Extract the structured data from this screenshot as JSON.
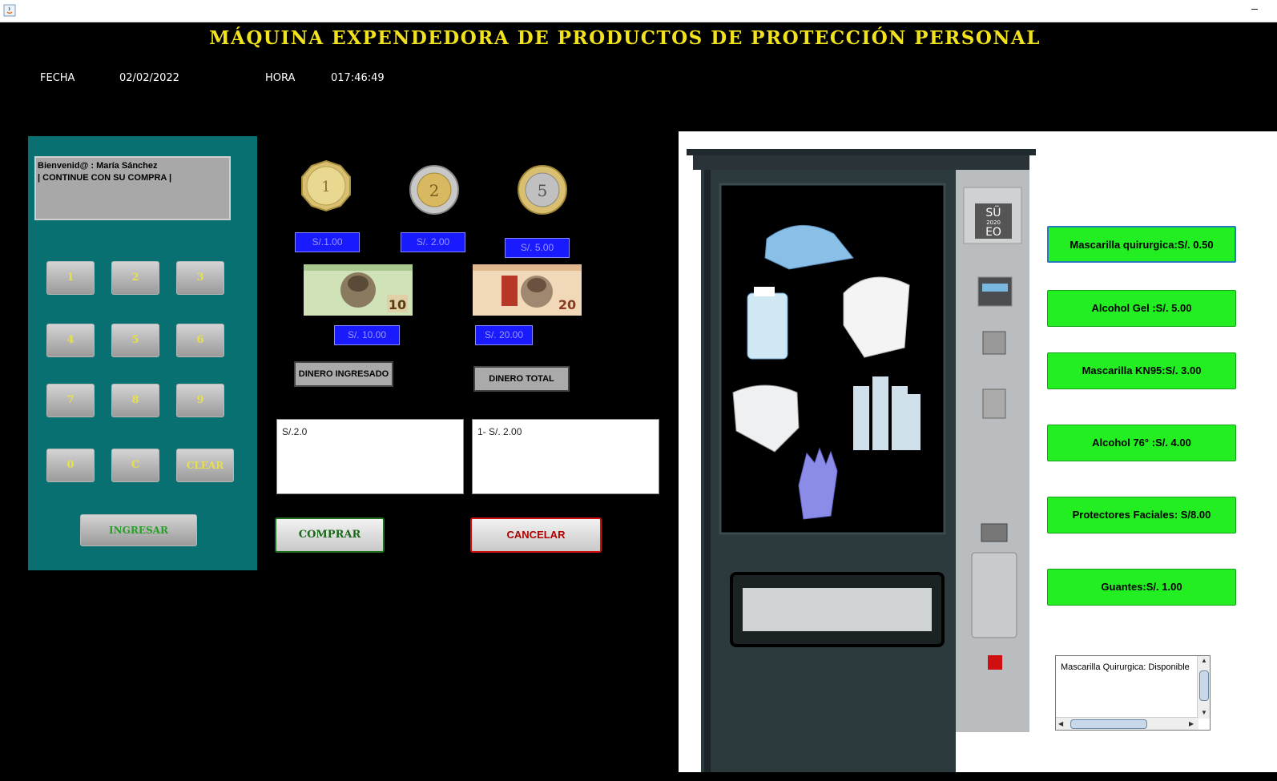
{
  "title": "MÁQUINA EXPENDEDORA DE PRODUCTOS DE PROTECCIÓN PERSONAL",
  "window": {
    "minimize": "–"
  },
  "header": {
    "fecha_label": "FECHA",
    "fecha_value": "02/02/2022",
    "hora_label": "HORA",
    "hora_value": "017:46:49"
  },
  "message": {
    "line1": "Bienvenid@ : María Sánchez",
    "line2": "| CONTINUE CON  SU COMPRA |"
  },
  "keypad": {
    "k1": "1",
    "k2": "2",
    "k3": "3",
    "k4": "4",
    "k5": "5",
    "k6": "6",
    "k7": "7",
    "k8": "8",
    "k9": "9",
    "k0": "0",
    "kc": "C",
    "clear": "CLEAR",
    "ingresar": "INGRESAR"
  },
  "money": {
    "coin1": "S/.1.00",
    "coin2": "S/. 2.00",
    "coin5": "S/. 5.00",
    "bill10": "S/. 10.00",
    "bill20": "S/. 20.00",
    "bill10_mark": "10",
    "bill20_mark": "20"
  },
  "labels": {
    "dinero_ingresado": "DINERO INGRESADO",
    "dinero_total": "DINERO TOTAL"
  },
  "fields": {
    "ingresado_value": "S/.2.0",
    "total_value": "1- S/. 2.00"
  },
  "actions": {
    "comprar": "COMPRAR",
    "cancelar": "CANCELAR"
  },
  "products": [
    {
      "label": "Mascarilla quirurgica:S/. 0.50"
    },
    {
      "label": "Alcohol Gel :S/. 5.00"
    },
    {
      "label": "Mascarilla KN95:S/. 3.00"
    },
    {
      "label": "Alcohol 76° :S/. 4.00"
    },
    {
      "label": "Protectores Faciales: S/8.00"
    },
    {
      "label": "Guantes:S/. 1.00"
    }
  ],
  "availability": {
    "text": "Mascarilla Quirurgica: Disponible"
  },
  "machine": {
    "brand_top": "SÜ",
    "brand_year": "2020",
    "brand_bottom": "EO"
  },
  "colors": {
    "title": "#f2e21e",
    "panel": "#087070",
    "product_button": "#22ee22",
    "money_button": "#1a1aff",
    "cancel": "#b00000",
    "comprar": "#1a6a1a"
  }
}
